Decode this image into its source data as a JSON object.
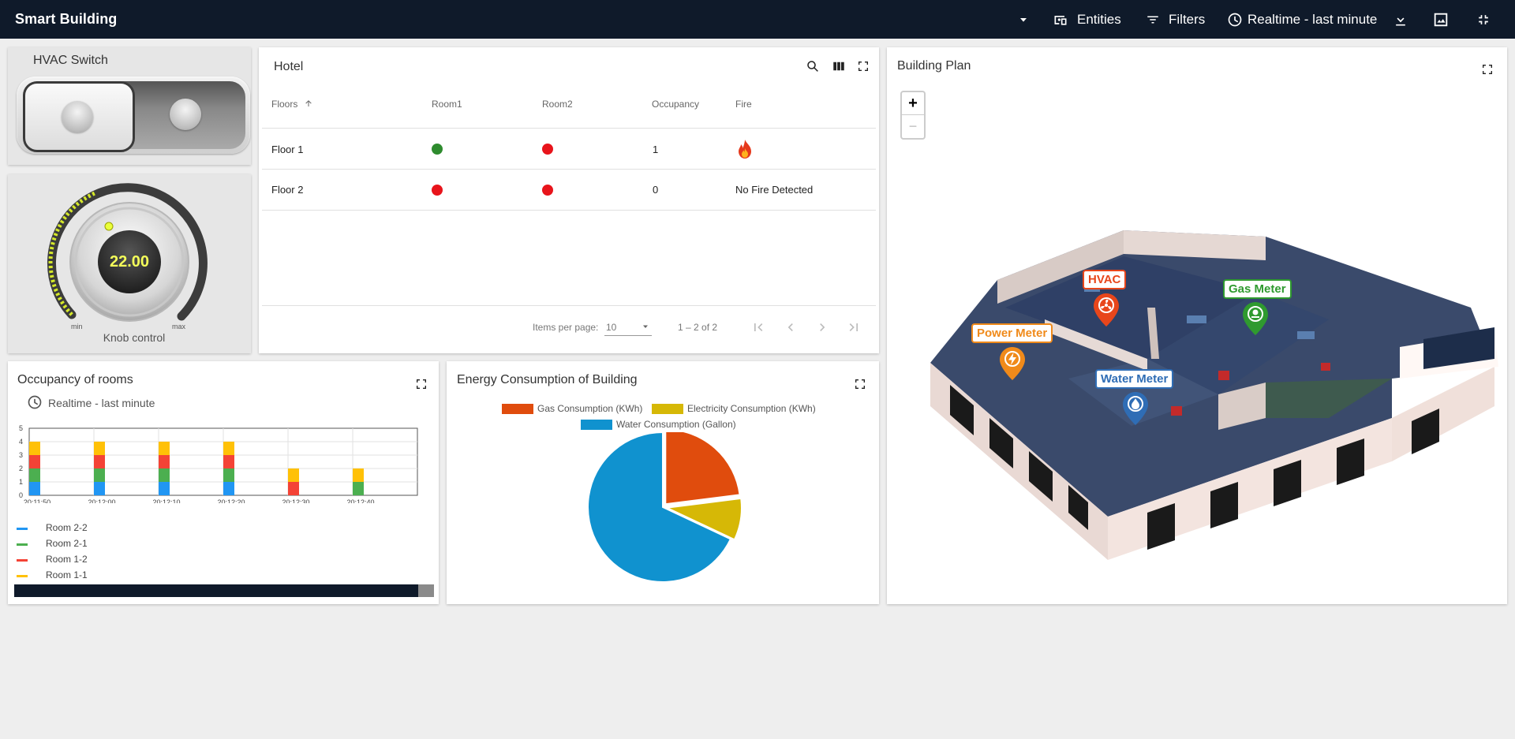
{
  "app": {
    "title": "Smart Building",
    "toolbar": {
      "entities_label": "Entities",
      "filters_label": "Filters",
      "time_label": "Realtime - last minute"
    }
  },
  "hvac_switch": {
    "title": "HVAC Switch",
    "state": "off"
  },
  "knob": {
    "value": "22.00",
    "label": "Knob control",
    "min_label": "min",
    "max_label": "max"
  },
  "hotel": {
    "title": "Hotel",
    "columns": [
      "Floors",
      "Room1",
      "Room2",
      "Occupancy",
      "Fire"
    ],
    "rows": [
      {
        "floor": "Floor 1",
        "room1": "#2e8b2e",
        "room2": "#e8141b",
        "occupancy": "1",
        "fire": "fire-icon"
      },
      {
        "floor": "Floor 2",
        "room1": "#e8141b",
        "room2": "#e8141b",
        "occupancy": "0",
        "fire": "No Fire Detected"
      }
    ],
    "paginator": {
      "items_per_page_label": "Items per page:",
      "page_size": "10",
      "range": "1 – 2 of 2"
    }
  },
  "building_plan": {
    "title": "Building Plan",
    "zoom_in": "+",
    "zoom_out": "−",
    "markers": [
      {
        "label": "HVAC",
        "color": "#e8461b",
        "icon": "fan-icon"
      },
      {
        "label": "Gas Meter",
        "color": "#2f9a2f",
        "icon": "gas-icon"
      },
      {
        "label": "Power Meter",
        "color": "#f08a1a",
        "icon": "lightning-icon"
      },
      {
        "label": "Water Meter",
        "color": "#2f6db5",
        "icon": "water-drop-icon"
      }
    ]
  },
  "occupancy": {
    "title": "Occupancy of rooms",
    "time_label": "Realtime - last minute",
    "chart_data": {
      "type": "bar",
      "stacked": true,
      "categories": [
        "20:11:50",
        "20:12:00",
        "20:12:10",
        "20:12:20",
        "20:12:30",
        "20:12:40"
      ],
      "ylim": [
        0,
        5
      ],
      "yticks": [
        "0",
        "1",
        "2",
        "3",
        "4",
        "5"
      ],
      "grid": true,
      "legend": "bottom",
      "series": [
        {
          "name": "Room 2-2",
          "color": "#2196f3",
          "values": [
            1,
            1,
            1,
            1,
            0,
            0
          ]
        },
        {
          "name": "Room 2-1",
          "color": "#4caf50",
          "values": [
            1,
            1,
            1,
            1,
            0,
            1
          ]
        },
        {
          "name": "Room 1-2",
          "color": "#f44336",
          "values": [
            1,
            1,
            1,
            1,
            1,
            0
          ]
        },
        {
          "name": "Room 1-1",
          "color": "#ffc107",
          "values": [
            1,
            1,
            1,
            1,
            1,
            1
          ]
        }
      ]
    }
  },
  "energy": {
    "title": "Energy Consumption of Building",
    "chart_data": {
      "type": "pie",
      "legend": "top",
      "labels": [
        "Gas Consumption (KWh)",
        "Electricity Consumption (KWh)",
        "Water Consumption (Gallon)"
      ],
      "colors": [
        "#e04c0d",
        "#d6b806",
        "#1092cf"
      ],
      "values": [
        23,
        9,
        68
      ]
    }
  }
}
